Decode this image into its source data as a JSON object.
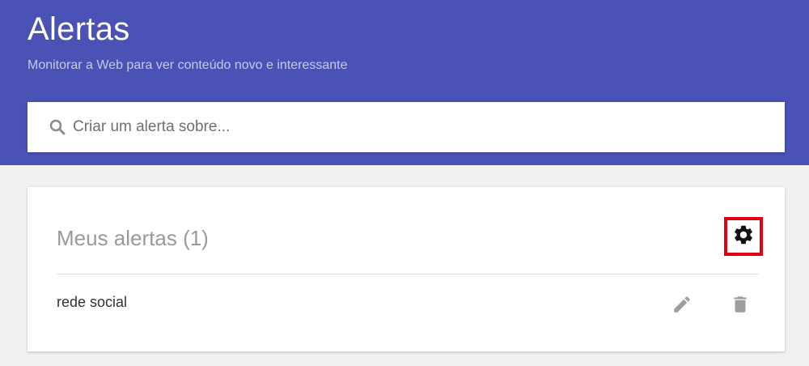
{
  "header": {
    "title": "Alertas",
    "subtitle": "Monitorar a Web para ver conteúdo novo e interessante"
  },
  "search": {
    "placeholder": "Criar um alerta sobre...",
    "value": ""
  },
  "alerts_card": {
    "title": "Meus alertas (1)",
    "items": [
      {
        "label": "rede social"
      }
    ]
  },
  "icons": {
    "search": "search-icon",
    "settings": "gear-icon",
    "edit": "pencil-icon",
    "delete": "trash-icon"
  },
  "colors": {
    "header_bg": "#4a52b5",
    "highlight": "#e3000f",
    "page_bg": "#f1f1f1"
  }
}
